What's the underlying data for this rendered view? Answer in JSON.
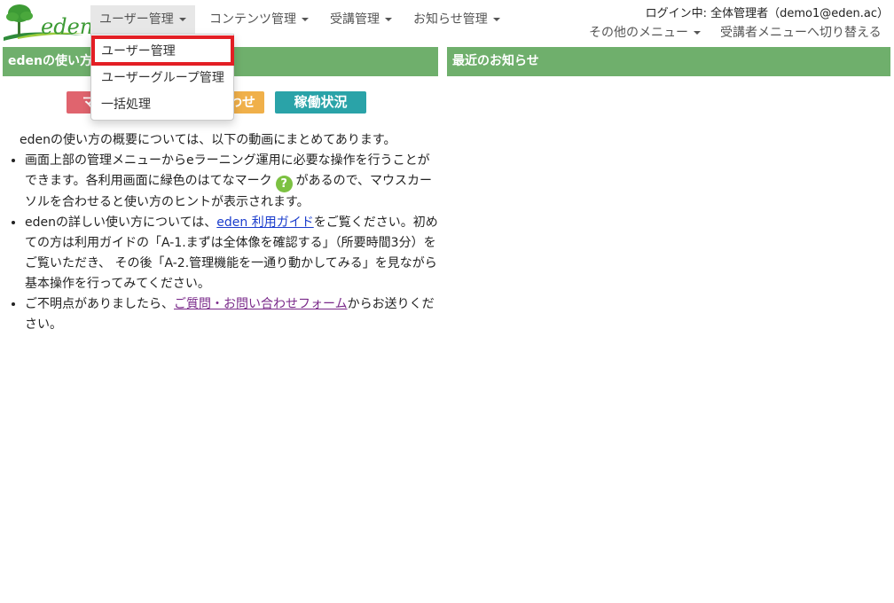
{
  "brand": {
    "name": "eden"
  },
  "nav": {
    "items": [
      {
        "label": "ユーザー管理"
      },
      {
        "label": "コンテンツ管理"
      },
      {
        "label": "受講管理"
      },
      {
        "label": "お知らせ管理"
      }
    ],
    "login_info": "ログイン中: 全体管理者（demo1@eden.ac）",
    "other_menu": "その他のメニュー",
    "switch_menu": "受講者メニューへ切り替える"
  },
  "dropdown": {
    "items": [
      {
        "label": "ユーザー管理"
      },
      {
        "label": "ユーザーグループ管理"
      },
      {
        "label": "一括処理"
      }
    ]
  },
  "panels": {
    "usage_title": "edenの使い方",
    "news_title": "最近のお知らせ"
  },
  "buttons": {
    "manual": "マニュアル",
    "contact": "お問い合わせ",
    "status": "稼働状況"
  },
  "usage": {
    "intro": "edenの使い方の概要については、以下の動画にまとめてあります。",
    "bullet1_a": "画面上部の管理メニューからeラーニング運用に必要な操作を行うことができます。各利用画面に緑色のはてなマーク",
    "help_mark": "?",
    "bullet1_b": "があるので、マウスカーソルを合わせると使い方のヒントが表示されます。",
    "bullet2_a": "edenの詳しい使い方については、",
    "bullet2_link": "eden 利用ガイド",
    "bullet2_b": "をご覧ください。初めての方は利用ガイドの「A-1.まずは全体像を確認する」（所要時間3分）をご覧いただき、 その後「A-2.管理機能を一通り動かしてみる」を見ながら基本操作を行ってみてください。",
    "bullet3_a": "ご不明点がありましたら、",
    "bullet3_link": "ご質問・お問い合わせフォーム",
    "bullet3_b": "からお送りください。"
  },
  "colors": {
    "panel_header": "#6faf6c",
    "btn_manual": "#e0646e",
    "btn_contact": "#f0b04a",
    "btn_status": "#2aa3a8",
    "highlight": "#e31e24",
    "help_icon": "#7cc142"
  }
}
